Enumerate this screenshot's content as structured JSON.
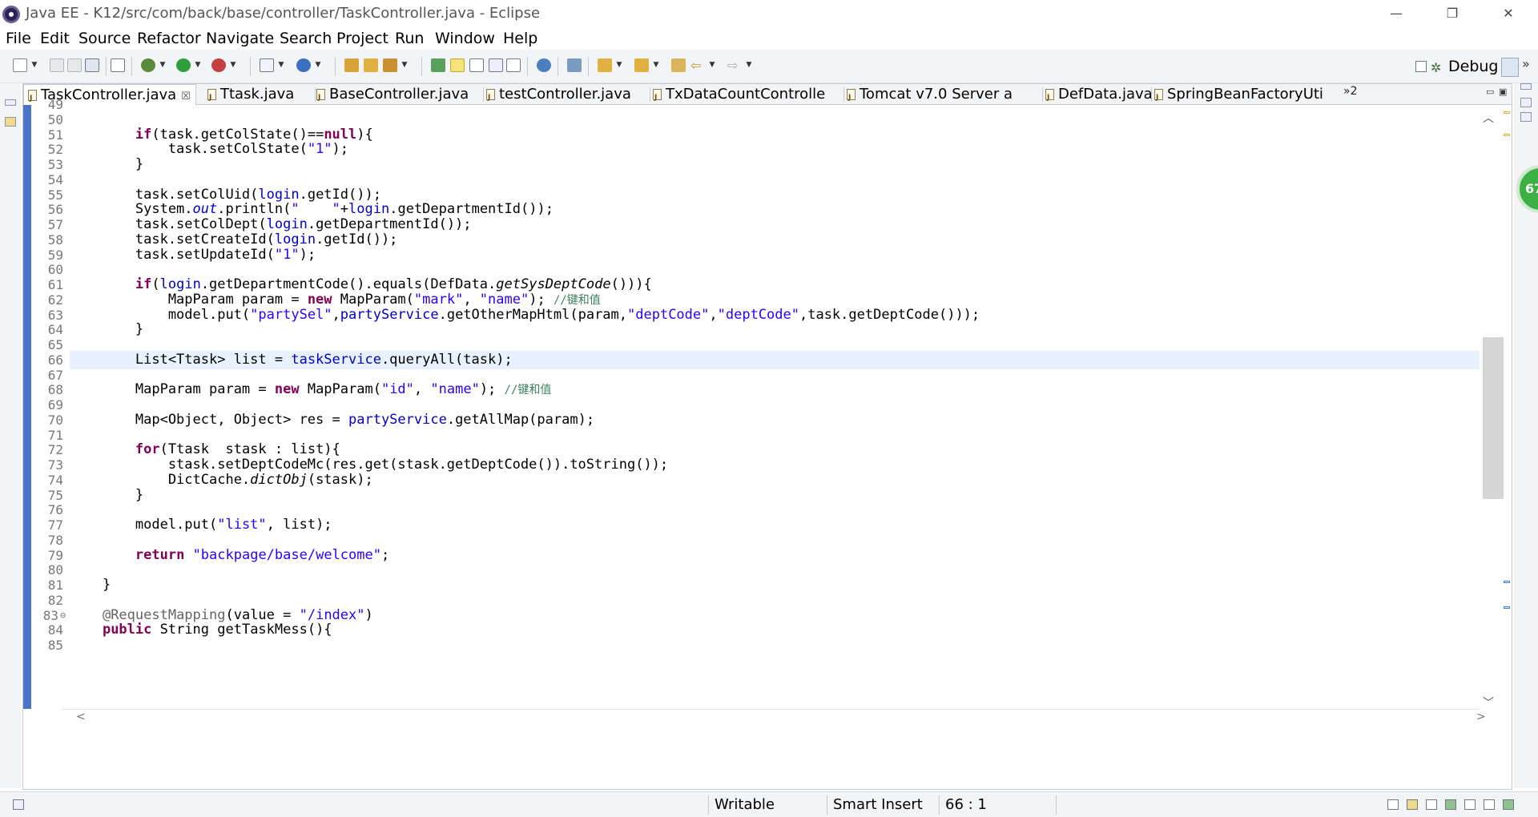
{
  "window": {
    "title": "Java EE - K12/src/com/back/base/controller/TaskController.java - Eclipse",
    "minimize": "—",
    "restore": "❐",
    "close": "✕"
  },
  "menu": [
    "File",
    "Edit",
    "Source",
    "Refactor",
    "Navigate",
    "Search",
    "Project",
    "Run",
    "Window",
    "Help"
  ],
  "toolbar": {
    "perspective_label": "Debug",
    "more": "»"
  },
  "tabs": [
    {
      "label": "TaskController.java",
      "active": true,
      "close": "☒"
    },
    {
      "label": "Ttask.java"
    },
    {
      "label": "BaseController.java"
    },
    {
      "label": "testController.java"
    },
    {
      "label": "TxDataCountControlle"
    },
    {
      "label": "Tomcat v7.0 Server a"
    },
    {
      "label": "DefData.java"
    },
    {
      "label": "SpringBeanFactoryUti"
    }
  ],
  "tab_overflow": "»2",
  "editor": {
    "first_line": 49,
    "current_line": 66,
    "lines": [
      "",
      "",
      "        <span class=\"kw\">if</span>(task.getColState()==<span class=\"kw\">null</span>){",
      "            task.setColState(<span class=\"str\">\"1\"</span>);",
      "        }",
      "",
      "        task.setColUid(<span class=\"fld\">login</span>.getId());",
      "        System.<span class=\"fld sta\">out</span>.println(<span class=\"str\">\"    \"</span>+<span class=\"fld\">login</span>.getDepartmentId());",
      "        task.setColDept(<span class=\"fld\">login</span>.getDepartmentId());",
      "        task.setCreateId(<span class=\"fld\">login</span>.getId());",
      "        task.setUpdateId(<span class=\"str\">\"1\"</span>);",
      "",
      "        <span class=\"kw\">if</span>(<span class=\"fld\">login</span>.getDepartmentCode().equals(DefData.<span class=\"sta\">getSysDeptCode</span>())){",
      "            MapParam param = <span class=\"kw\">new</span> MapParam(<span class=\"str\">\"mark\"</span>, <span class=\"str\">\"name\"</span>); <span class=\"cmt\">//键和值</span>",
      "            model.put(<span class=\"str\">\"partySel\"</span>,<span class=\"fld\">partyService</span>.getOtherMapHtml(param,<span class=\"str\">\"deptCode\"</span>,<span class=\"str\">\"deptCode\"</span>,task.getDeptCode()));",
      "        }",
      "",
      "        List&lt;Ttask&gt; list = <span class=\"fld\">taskService</span>.queryAll(task);",
      "",
      "        MapParam param = <span class=\"kw\">new</span> MapParam(<span class=\"str\">\"id\"</span>, <span class=\"str\">\"name\"</span>); <span class=\"cmt\">//键和值</span>",
      "",
      "        Map&lt;Object, Object&gt; res = <span class=\"fld\">partyService</span>.getAllMap(param);",
      "",
      "        <span class=\"kw\">for</span>(Ttask  stask : list){",
      "            stask.setDeptCodeMc(res.get(stask.getDeptCode()).toString());",
      "            DictCache.<span class=\"sta\">dictObj</span>(stask);",
      "        }",
      "",
      "        model.put(<span class=\"str\">\"list\"</span>, list);",
      "",
      "        <span class=\"kw\">return</span> <span class=\"str\">\"backpage/base/welcome\"</span>;",
      "",
      "    }",
      "",
      "    <span class=\"ann\">@RequestMapping</span>(value = <span class=\"str\">\"/index\"</span>)",
      "    <span class=\"kw\">public</span> String getTaskMess(){",
      ""
    ],
    "fold_marker": "⊖",
    "badge": "67"
  },
  "status": {
    "writable": "Writable",
    "insert_mode": "Smart Insert",
    "cursor_position": "66 : 1"
  },
  "colors": {
    "accent": "#4a74c8",
    "keyword": "#7f0055",
    "string": "#2a00ff",
    "field": "#0000c0",
    "comment": "#3f7f5f",
    "current_line": "#e8f2fe"
  }
}
